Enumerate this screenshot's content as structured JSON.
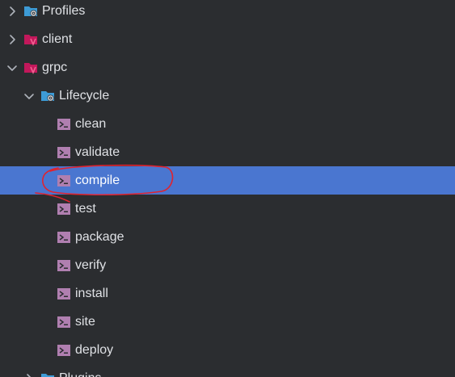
{
  "tree": {
    "items": [
      {
        "label": "Profiles",
        "icon": "profiles-folder-icon",
        "expanded": false
      },
      {
        "label": "client",
        "icon": "maven-module-icon",
        "expanded": false
      },
      {
        "label": "grpc",
        "icon": "maven-module-icon",
        "expanded": true
      },
      {
        "label": "Lifecycle",
        "icon": "lifecycle-folder-icon",
        "expanded": true
      },
      {
        "label": "clean",
        "icon": "maven-goal-icon"
      },
      {
        "label": "validate",
        "icon": "maven-goal-icon"
      },
      {
        "label": "compile",
        "icon": "maven-goal-icon",
        "selected": true
      },
      {
        "label": "test",
        "icon": "maven-goal-icon"
      },
      {
        "label": "package",
        "icon": "maven-goal-icon"
      },
      {
        "label": "verify",
        "icon": "maven-goal-icon"
      },
      {
        "label": "install",
        "icon": "maven-goal-icon"
      },
      {
        "label": "site",
        "icon": "maven-goal-icon"
      },
      {
        "label": "deploy",
        "icon": "maven-goal-icon"
      },
      {
        "label": "Plugins",
        "icon": "plugins-folder-icon",
        "expanded": false
      }
    ]
  },
  "colors": {
    "background": "#2b2d30",
    "selection": "#4a76d0",
    "text": "#dfe1e5",
    "folder": "#3d9bd6",
    "maven": "#c2185b",
    "goal": "#b07fb0",
    "annotation": "#e0232f"
  }
}
